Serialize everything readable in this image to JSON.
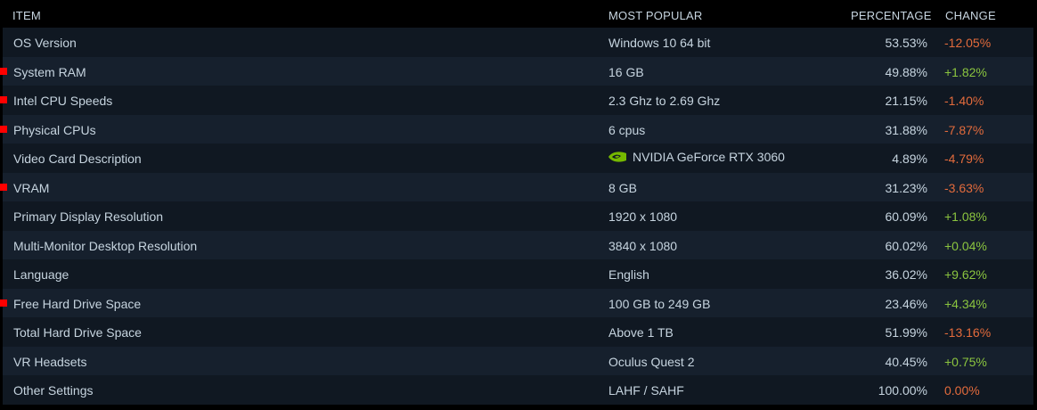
{
  "header": {
    "item": "ITEM",
    "most_popular": "MOST POPULAR",
    "percentage": "PERCENTAGE",
    "change": "CHANGE"
  },
  "colors": {
    "positive": "#8bc53f",
    "negative": "#e36b3c",
    "marker": "#ff0000",
    "nvidia_green": "#76b900"
  },
  "rows": [
    {
      "item": "OS Version",
      "popular": "Windows 10 64 bit",
      "percentage": "53.53%",
      "change": "-12.05%",
      "marked": false,
      "icon": null
    },
    {
      "item": "System RAM",
      "popular": "16 GB",
      "percentage": "49.88%",
      "change": "+1.82%",
      "marked": true,
      "icon": null
    },
    {
      "item": "Intel CPU Speeds",
      "popular": "2.3 Ghz to 2.69 Ghz",
      "percentage": "21.15%",
      "change": "-1.40%",
      "marked": true,
      "icon": null
    },
    {
      "item": "Physical CPUs",
      "popular": "6 cpus",
      "percentage": "31.88%",
      "change": "-7.87%",
      "marked": true,
      "icon": null
    },
    {
      "item": "Video Card Description",
      "popular": "NVIDIA GeForce RTX 3060",
      "percentage": "4.89%",
      "change": "-4.79%",
      "marked": false,
      "icon": "nvidia-logo-icon"
    },
    {
      "item": "VRAM",
      "popular": "8 GB",
      "percentage": "31.23%",
      "change": "-3.63%",
      "marked": true,
      "icon": null
    },
    {
      "item": "Primary Display Resolution",
      "popular": "1920 x 1080",
      "percentage": "60.09%",
      "change": "+1.08%",
      "marked": false,
      "icon": null
    },
    {
      "item": "Multi-Monitor Desktop Resolution",
      "popular": "3840 x 1080",
      "percentage": "60.02%",
      "change": "+0.04%",
      "marked": false,
      "icon": null
    },
    {
      "item": "Language",
      "popular": "English",
      "percentage": "36.02%",
      "change": "+9.62%",
      "marked": false,
      "icon": null
    },
    {
      "item": "Free Hard Drive Space",
      "popular": "100 GB to 249 GB",
      "percentage": "23.46%",
      "change": "+4.34%",
      "marked": true,
      "icon": null
    },
    {
      "item": "Total Hard Drive Space",
      "popular": "Above 1 TB",
      "percentage": "51.99%",
      "change": "-13.16%",
      "marked": false,
      "icon": null
    },
    {
      "item": "VR Headsets",
      "popular": "Oculus Quest 2",
      "percentage": "40.45%",
      "change": "+0.75%",
      "marked": false,
      "icon": null
    },
    {
      "item": "Other Settings",
      "popular": "LAHF / SAHF",
      "percentage": "100.00%",
      "change": "0.00%",
      "marked": false,
      "icon": null
    }
  ]
}
